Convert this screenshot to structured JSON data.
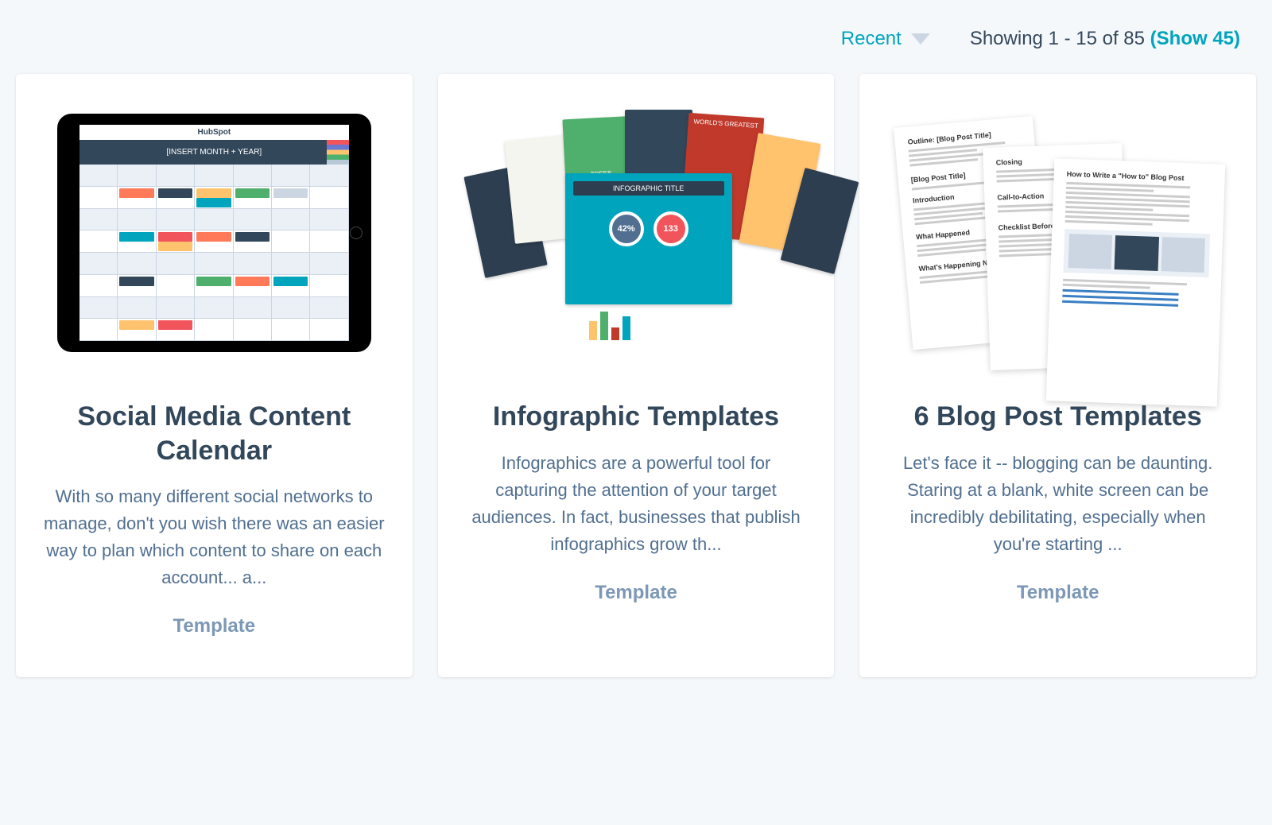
{
  "sort": {
    "label": "Recent"
  },
  "results": {
    "text": "Showing 1 - 15 of 85 ",
    "show_more": "(Show 45)"
  },
  "cards": [
    {
      "title": "Social Media Content Calendar",
      "description": "With so many different social networks to manage, don't you wish there was an easier way to plan which content to share on each account... a...",
      "label": "Template",
      "mock": {
        "brand": "HubSpot",
        "header": "[INSERT MONTH + YEAR]"
      }
    },
    {
      "title": "Infographic Templates",
      "description": "Infographics are a powerful tool for capturing the attention of your target audiences. In fact, businesses that publish infographics grow th...",
      "label": "Template",
      "mock": {
        "front_title": "INFOGRAPHIC TITLE",
        "bubble1": "42%",
        "bubble2": "133",
        "trees": "TREES",
        "red_title": "WORLD'S GREATEST"
      }
    },
    {
      "title": "6 Blog Post Templates",
      "description": "Let's face it -- blogging can be daunting. Staring at a blank, white screen can be incredibly debilitating, especially when you're starting ...",
      "label": "Template",
      "mock": {
        "doc1_h1": "Outline: [Blog Post Title]",
        "doc1_h2": "[Blog Post Title]",
        "doc1_h3": "Introduction",
        "doc1_h4": "What Happened",
        "doc1_h5": "What's Happening Now/Nex",
        "doc2_h1": "Closing",
        "doc2_h2": "Call-to-Action",
        "doc2_h3": "Checklist Before",
        "doc3_h1": "How to Write a \"How to\" Blog Post"
      }
    }
  ]
}
